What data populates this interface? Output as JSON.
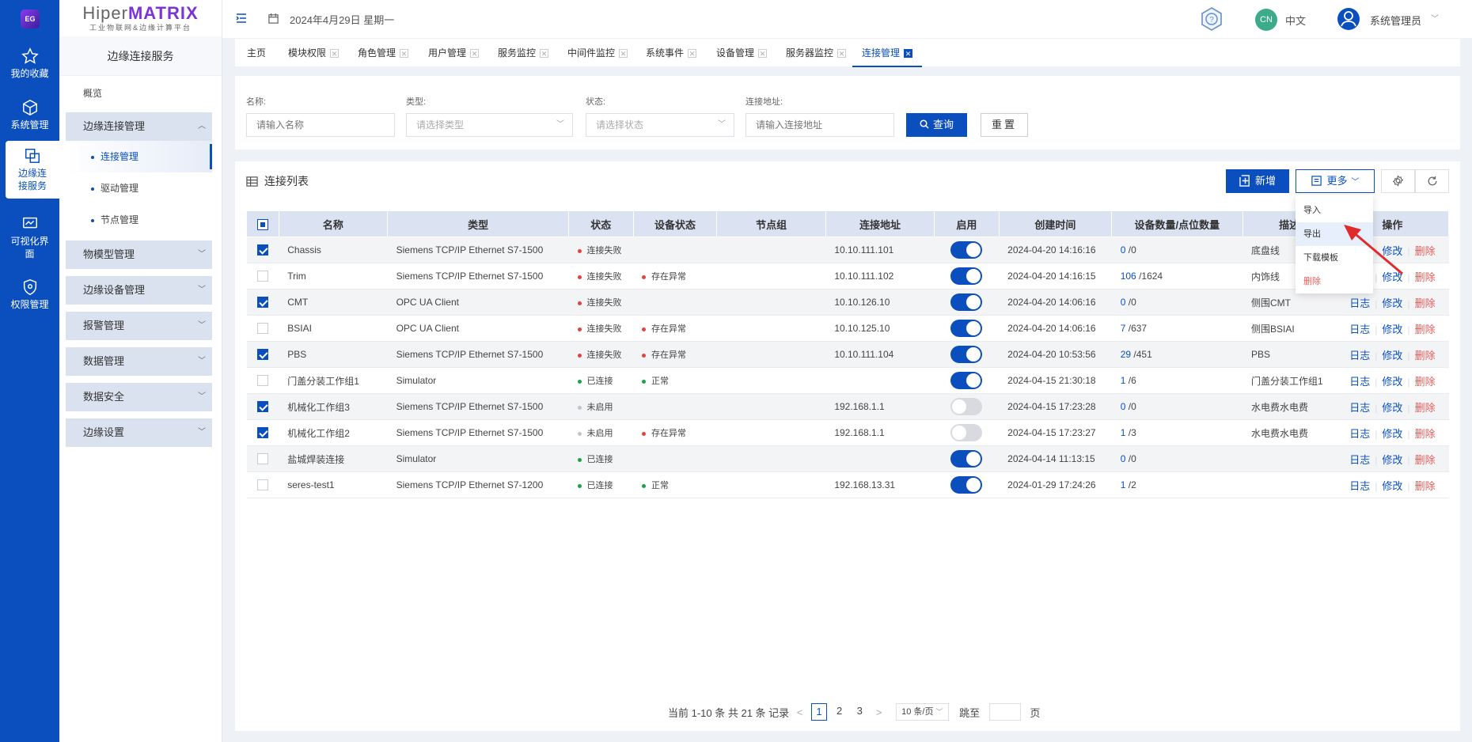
{
  "rail": {
    "logo": "EG",
    "items": [
      {
        "label": "我的收藏"
      },
      {
        "label": "系统管理"
      },
      {
        "label": "边缘连接服务"
      },
      {
        "label": "可视化界面"
      },
      {
        "label": "权限管理"
      }
    ]
  },
  "brand": {
    "hiper": "Hiper",
    "matrix": "MATRIX",
    "tagline": "工业物联网&边缘计算平台"
  },
  "sidebar": {
    "title": "边缘连接服务",
    "overview": "概览",
    "groups": [
      {
        "label": "边缘连接管理",
        "expanded": true,
        "children": [
          {
            "label": "连接管理",
            "active": true
          },
          {
            "label": "驱动管理"
          },
          {
            "label": "节点管理"
          }
        ]
      },
      {
        "label": "物模型管理"
      },
      {
        "label": "边缘设备管理"
      },
      {
        "label": "报警管理"
      },
      {
        "label": "数据管理"
      },
      {
        "label": "数据安全"
      },
      {
        "label": "边缘设置"
      }
    ]
  },
  "header": {
    "date": "2024年4月29日 星期一",
    "lang_badge": "CN",
    "lang": "中文",
    "user": "系统管理员"
  },
  "tabs": [
    {
      "label": "主页"
    },
    {
      "label": "模块权限"
    },
    {
      "label": "角色管理"
    },
    {
      "label": "用户管理"
    },
    {
      "label": "服务监控"
    },
    {
      "label": "中间件监控"
    },
    {
      "label": "系统事件"
    },
    {
      "label": "设备管理"
    },
    {
      "label": "服务器监控"
    },
    {
      "label": "连接管理"
    }
  ],
  "filters": {
    "name": {
      "label": "名称:",
      "placeholder": "请输入名称"
    },
    "type": {
      "label": "类型:",
      "placeholder": "请选择类型"
    },
    "status": {
      "label": "状态:",
      "placeholder": "请选择状态"
    },
    "address": {
      "label": "连接地址:",
      "placeholder": "请输入连接地址"
    },
    "search": "查询",
    "reset": "重置"
  },
  "list": {
    "title": "连接列表",
    "add": "新增",
    "more": "更多",
    "columns": [
      "名称",
      "类型",
      "状态",
      "设备状态",
      "节点组",
      "连接地址",
      "启用",
      "创建时间",
      "设备数量/点位数量",
      "描述",
      "操作"
    ],
    "ops": {
      "log": "日志",
      "edit": "修改",
      "del": "删除"
    },
    "rows": [
      {
        "checked": true,
        "name": "Chassis",
        "type": "Siemens TCP/IP Ethernet S7-1500",
        "status": "连接失败",
        "status_color": "#e8413c",
        "dev_status": "",
        "dev_color": "",
        "group": "",
        "addr": "10.10.111.101",
        "enabled": true,
        "created": "2024-04-20 14:16:16",
        "dev_count": "0",
        "point_count": "/0",
        "desc": "底盘线"
      },
      {
        "checked": false,
        "name": "Trim",
        "type": "Siemens TCP/IP Ethernet S7-1500",
        "status": "连接失败",
        "status_color": "#e8413c",
        "dev_status": "存在异常",
        "dev_color": "#e8413c",
        "group": "",
        "addr": "10.10.111.102",
        "enabled": true,
        "created": "2024-04-20 14:16:15",
        "dev_count": "106",
        "point_count": "/1624",
        "desc": "内饰线"
      },
      {
        "checked": true,
        "name": "CMT",
        "type": "OPC UA Client",
        "status": "连接失败",
        "status_color": "#e8413c",
        "dev_status": "",
        "dev_color": "",
        "group": "",
        "addr": "10.10.126.10",
        "enabled": true,
        "created": "2024-04-20 14:06:16",
        "dev_count": "0",
        "point_count": "/0",
        "desc": "侧围CMT"
      },
      {
        "checked": false,
        "name": "BSIAI",
        "type": "OPC UA Client",
        "status": "连接失败",
        "status_color": "#e8413c",
        "dev_status": "存在异常",
        "dev_color": "#e8413c",
        "group": "",
        "addr": "10.10.125.10",
        "enabled": true,
        "created": "2024-04-20 14:06:16",
        "dev_count": "7",
        "point_count": "/637",
        "desc": "侧围BSIAI"
      },
      {
        "checked": true,
        "name": "PBS",
        "type": "Siemens TCP/IP Ethernet S7-1500",
        "status": "连接失败",
        "status_color": "#e8413c",
        "dev_status": "存在异常",
        "dev_color": "#e8413c",
        "group": "",
        "addr": "10.10.111.104",
        "enabled": true,
        "created": "2024-04-20 10:53:56",
        "dev_count": "29",
        "point_count": "/451",
        "desc": "PBS"
      },
      {
        "checked": false,
        "name": "门盖分装工作组1",
        "type": "Simulator",
        "status": "已连接",
        "status_color": "#1aa34a",
        "dev_status": "正常",
        "dev_color": "#1aa34a",
        "group": "",
        "addr": "",
        "enabled": true,
        "created": "2024-04-15 21:30:18",
        "dev_count": "1",
        "point_count": "/6",
        "desc": "门盖分装工作组1"
      },
      {
        "checked": true,
        "name": "机械化工作组3",
        "type": "Siemens TCP/IP Ethernet S7-1500",
        "status": "未启用",
        "status_color": "#c0c4cc",
        "dev_status": "",
        "dev_color": "",
        "group": "",
        "addr": "192.168.1.1",
        "enabled": false,
        "created": "2024-04-15 17:23:28",
        "dev_count": "0",
        "point_count": "/0",
        "desc": "水电费水电费"
      },
      {
        "checked": true,
        "name": "机械化工作组2",
        "type": "Siemens TCP/IP Ethernet S7-1500",
        "status": "未启用",
        "status_color": "#c0c4cc",
        "dev_status": "存在异常",
        "dev_color": "#e8413c",
        "group": "",
        "addr": "192.168.1.1",
        "enabled": false,
        "created": "2024-04-15 17:23:27",
        "dev_count": "1",
        "point_count": "/3",
        "desc": "水电费水电费"
      },
      {
        "checked": false,
        "name": "盐城焊装连接",
        "type": "Simulator",
        "status": "已连接",
        "status_color": "#1aa34a",
        "dev_status": "",
        "dev_color": "",
        "group": "",
        "addr": "",
        "enabled": true,
        "created": "2024-04-14 11:13:15",
        "dev_count": "0",
        "point_count": "/0",
        "desc": ""
      },
      {
        "checked": false,
        "name": "seres-test1",
        "type": "Siemens TCP/IP Ethernet S7-1200",
        "status": "已连接",
        "status_color": "#1aa34a",
        "dev_status": "正常",
        "dev_color": "#1aa34a",
        "group": "",
        "addr": "192.168.13.31",
        "enabled": true,
        "created": "2024-01-29 17:24:26",
        "dev_count": "1",
        "point_count": "/2",
        "desc": ""
      }
    ]
  },
  "more_menu": {
    "items": [
      {
        "label": "导入"
      },
      {
        "label": "导出",
        "hover": true
      },
      {
        "label": "下载模板"
      },
      {
        "label": "删除",
        "danger": true
      }
    ]
  },
  "pagination": {
    "summary": "当前 1-10 条 共 21 条 记录",
    "pages": [
      "1",
      "2",
      "3"
    ],
    "current": "1",
    "page_size": "10 条/页",
    "jump_label": "跳至",
    "page_suffix": "页"
  },
  "colors": {
    "primary": "#0b4fbf",
    "danger": "#f05a5a",
    "success": "#1aa34a",
    "annotation_arrow": "#e02b2b"
  }
}
